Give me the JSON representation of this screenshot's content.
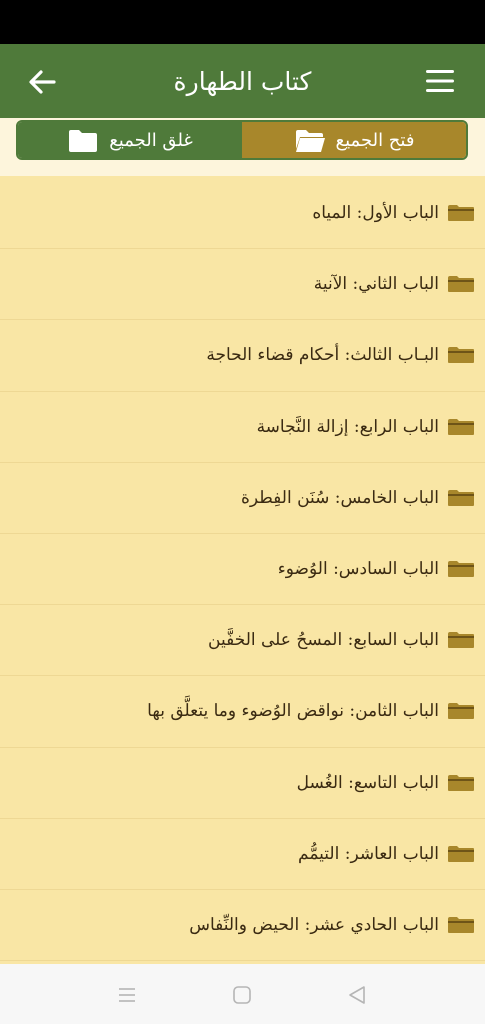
{
  "app_bar": {
    "title": "كتاب الطهارة",
    "back_icon": "arrow-left-icon",
    "menu_icon": "hamburger-menu-icon"
  },
  "toggles": {
    "collapse_all_label": "غلق الجميع",
    "expand_all_label": "فتح الجميع"
  },
  "chapters": [
    {
      "label": "الباب الأول: المياه"
    },
    {
      "label": "الباب الثاني: الآنية"
    },
    {
      "label": "البـاب الثالث: أحكام قضاء الحاجة"
    },
    {
      "label": "الباب الرابع: إزالة النَّجاسة"
    },
    {
      "label": "الباب الخامس: سُنَن الفِطرة"
    },
    {
      "label": "الباب السادس: الوُضوء"
    },
    {
      "label": "الباب السابع: المسحُ على الخفَّين"
    },
    {
      "label": "الباب الثامن: نواقض الوُضوء وما يتعلَّق بها"
    },
    {
      "label": "الباب التاسع: الغُسل"
    },
    {
      "label": "الباب العاشر: التيمُّم"
    },
    {
      "label": "الباب الحادي عشر: الحيض والنِّفاس"
    }
  ],
  "colors": {
    "app_bar": "#4f7a3a",
    "expand_button": "#a8872b",
    "list_background": "#f9e6a5",
    "folder": "#a8872b"
  }
}
